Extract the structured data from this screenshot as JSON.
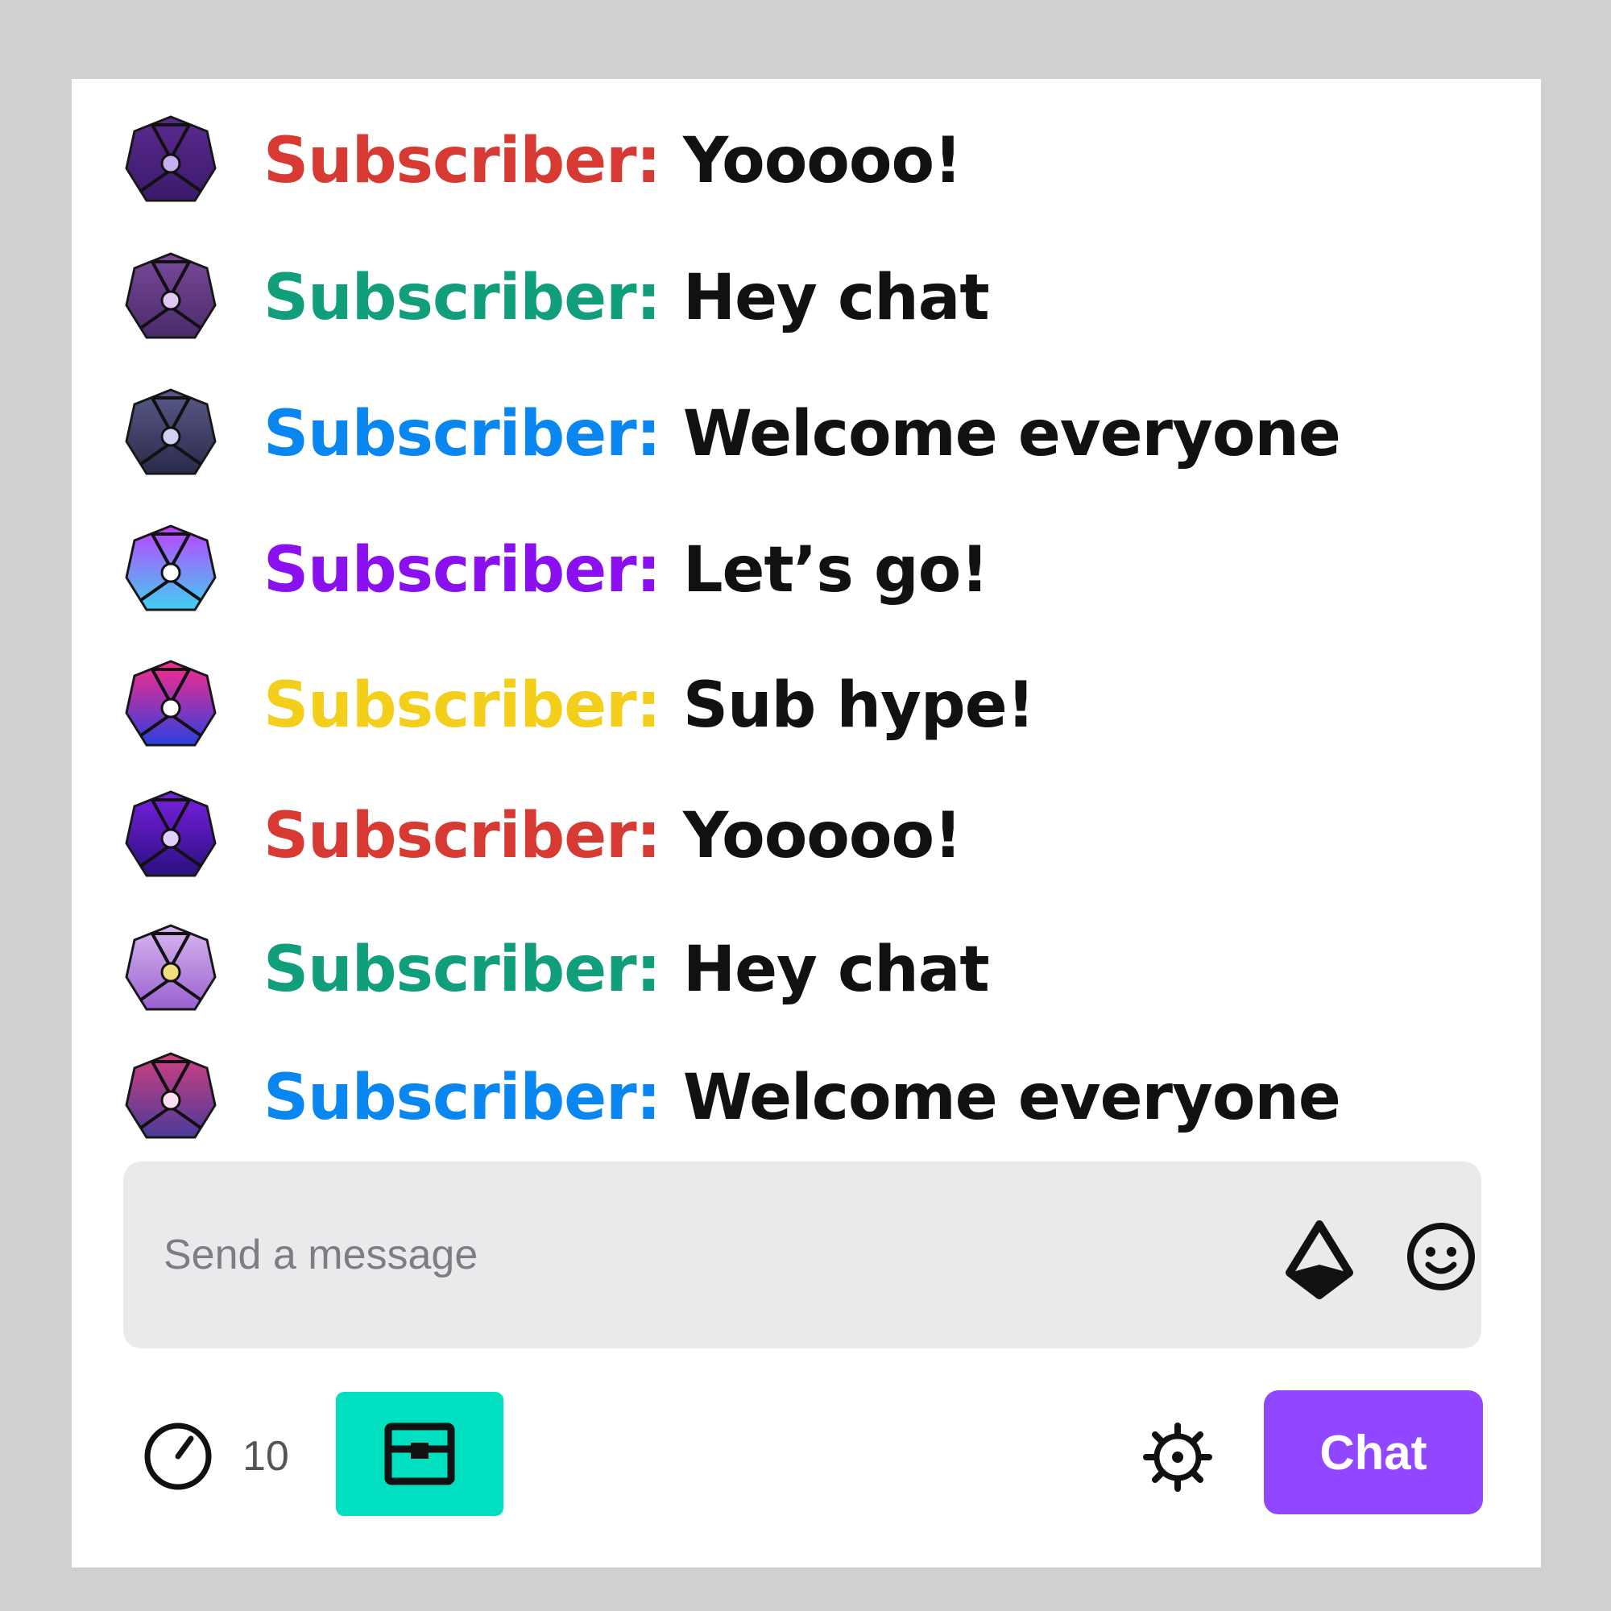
{
  "chat": {
    "messages": [
      {
        "author": "Subscriber:",
        "text": "Yooooo!",
        "author_color": "#d63a33",
        "badge": {
          "top": "#5a2a8f",
          "bottom": "#3b1a6b",
          "core": "#c8b0f0"
        }
      },
      {
        "author": "Subscriber:",
        "text": "Hey chat",
        "author_color": "#119e7a",
        "badge": {
          "top": "#7a4a9a",
          "bottom": "#4a2a6a",
          "core": "#e0c8f0"
        }
      },
      {
        "author": "Subscriber:",
        "text": "Welcome everyone",
        "author_color": "#0a86f0",
        "badge": {
          "top": "#5a5a8a",
          "bottom": "#2a2a4a",
          "core": "#d0d0f0"
        }
      },
      {
        "author": "Subscriber:",
        "text": "Let’s go!",
        "author_color": "#8a10f0",
        "badge": {
          "top": "#c040ff",
          "bottom": "#40d0f0",
          "core": "#ffffff"
        }
      },
      {
        "author": "Subscriber:",
        "text": "Sub hype!",
        "author_color": "#f3cf1c",
        "badge": {
          "top": "#ff2a8a",
          "bottom": "#2a40e0",
          "core": "#ffffff"
        }
      },
      {
        "author": "Subscriber:",
        "text": "Yooooo!",
        "author_color": "#d63a33",
        "badge": {
          "top": "#7a20e0",
          "bottom": "#2a1080",
          "core": "#e0d0ff"
        }
      },
      {
        "author": "Subscriber:",
        "text": "Hey chat",
        "author_color": "#119e7a",
        "badge": {
          "top": "#d8b8f0",
          "bottom": "#9a60d0",
          "core": "#f0e080"
        }
      },
      {
        "author": "Subscriber:",
        "text": "Welcome everyone",
        "author_color": "#0a86f0",
        "badge": {
          "top": "#d04080",
          "bottom": "#4a3a9a",
          "core": "#ffe0f0"
        }
      }
    ]
  },
  "input": {
    "placeholder": "Send a message",
    "bits_icon": "bits-icon",
    "emote_icon": "smiley-icon"
  },
  "footer": {
    "points_icon": "channel-points-icon",
    "points_count": "10",
    "reward_icon": "treasure-chest-icon",
    "reward_color": "#00e0c0",
    "settings_icon": "gear-icon",
    "chat_button_label": "Chat",
    "chat_button_color": "#9147ff"
  }
}
